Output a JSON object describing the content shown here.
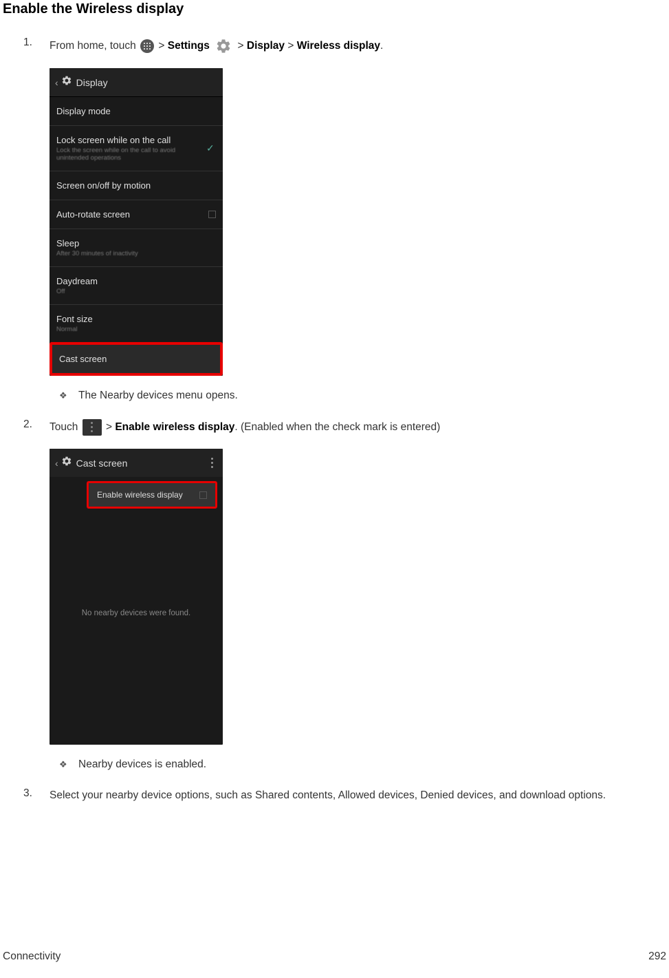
{
  "title": "Enable the Wireless display",
  "step1": {
    "prefix": "From home, touch ",
    "sep1": " > ",
    "settings": "Settings",
    "sep2": " > ",
    "display": "Display",
    "sep3": " > ",
    "wireless_display": "Wireless display",
    "period": "."
  },
  "screenshot1": {
    "header_title": "Display",
    "rows": {
      "display_mode": "Display mode",
      "lock_screen": {
        "title": "Lock screen while on the call",
        "sub": "Lock the screen while on the call to avoid unintended operations"
      },
      "screen_motion": "Screen on/off by motion",
      "auto_rotate": "Auto-rotate screen",
      "sleep": {
        "title": "Sleep",
        "sub": "After 30 minutes of inactivity"
      },
      "daydream": {
        "title": "Daydream",
        "sub": "Off"
      },
      "font_size": {
        "title": "Font size",
        "sub": "Normal"
      },
      "cast_screen": "Cast screen"
    }
  },
  "bullet1": "The Nearby devices menu opens.",
  "step2": {
    "prefix": "Touch ",
    "sep": " > ",
    "enable": "Enable wireless display",
    "suffix": ". (Enabled when the check mark is entered)"
  },
  "screenshot2": {
    "header_title": "Cast screen",
    "popup_text": "Enable wireless display",
    "body_msg": "No nearby devices were found."
  },
  "bullet2": "Nearby devices is enabled.",
  "step3": "Select your nearby device options, such as Shared contents, Allowed devices, Denied devices, and download options.",
  "footer_left": "Connectivity",
  "footer_right": "292"
}
